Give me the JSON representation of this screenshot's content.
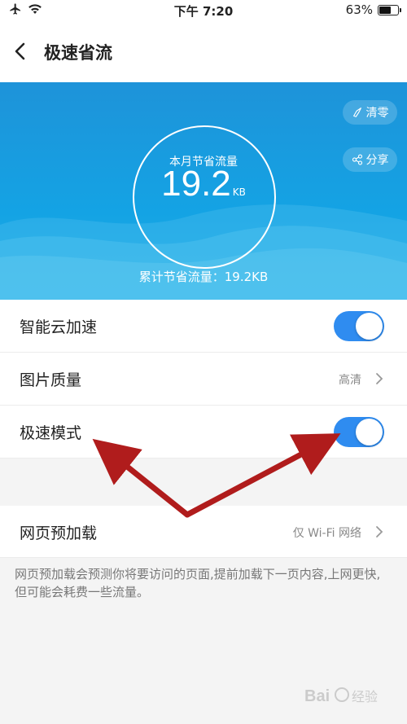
{
  "status_bar": {
    "time": "下午 7:20",
    "battery": "63%",
    "battery_level": 0.63
  },
  "nav": {
    "title": "极速省流"
  },
  "hero": {
    "clear_label": "清零",
    "share_label": "分享",
    "month_label": "本月节省流量",
    "month_value": "19.2",
    "month_unit": "KB",
    "cumulative": "累计节省流量：19.2KB"
  },
  "settings": {
    "smart_cloud": {
      "label": "智能云加速",
      "on": true
    },
    "image_quality": {
      "label": "图片质量",
      "value": "高清"
    },
    "speed_mode": {
      "label": "极速模式",
      "on": true
    },
    "web_preload": {
      "label": "网页预加载",
      "value": "仅 Wi-Fi 网络"
    },
    "description": "网页预加载会预测你将要访问的页面,提前加载下一页内容,上网更快,但可能会耗费一些流量。"
  },
  "colors": {
    "accent": "#2f8cf0",
    "hero": "#1a9be0",
    "arrow": "#b01c1c"
  },
  "watermark": "Bai 经验"
}
